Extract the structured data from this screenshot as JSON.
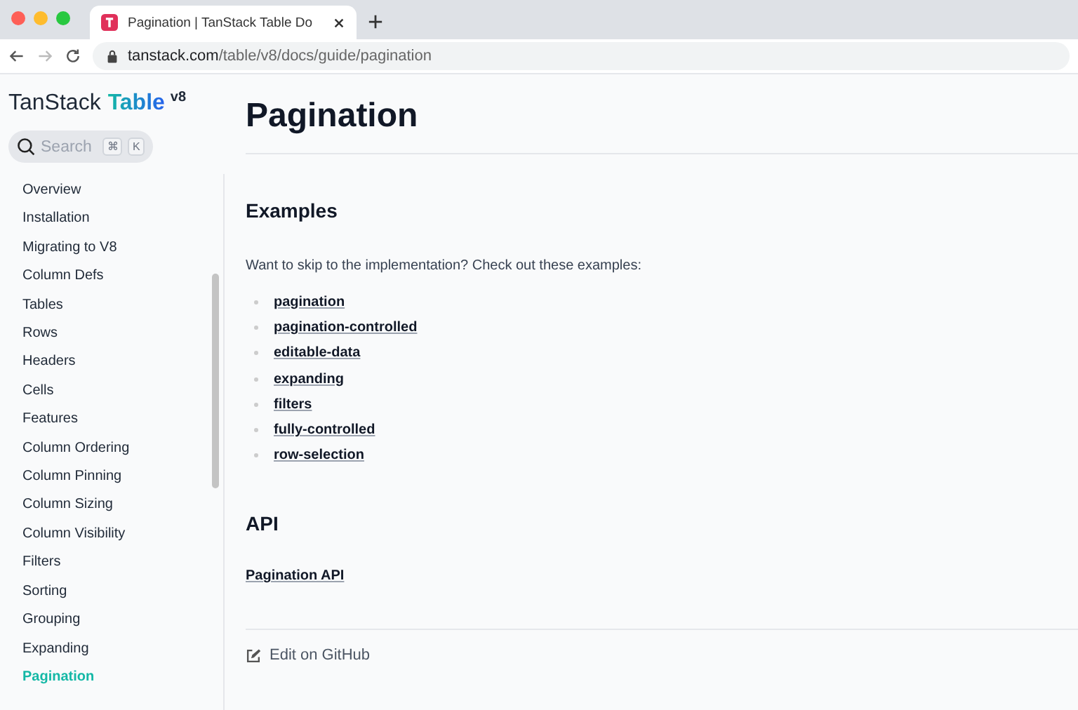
{
  "browser": {
    "tab_title": "Pagination | TanStack Table Do",
    "url_host": "tanstack.com",
    "url_path": "/table/v8/docs/guide/pagination"
  },
  "sidebar": {
    "logo": {
      "brand": "TanStack",
      "product": "Table",
      "version": "v8"
    },
    "search": {
      "placeholder": "Search",
      "keys": [
        "⌘",
        "K"
      ]
    },
    "items": [
      {
        "label": "Overview",
        "selected": false
      },
      {
        "label": "Installation",
        "selected": false
      },
      {
        "label": "Migrating to V8",
        "selected": false
      },
      {
        "label": "Column Defs",
        "selected": false
      },
      {
        "label": "Tables",
        "selected": false
      },
      {
        "label": "Rows",
        "selected": false
      },
      {
        "label": "Headers",
        "selected": false
      },
      {
        "label": "Cells",
        "selected": false
      },
      {
        "label": "Features",
        "selected": false
      },
      {
        "label": "Column Ordering",
        "selected": false
      },
      {
        "label": "Column Pinning",
        "selected": false
      },
      {
        "label": "Column Sizing",
        "selected": false
      },
      {
        "label": "Column Visibility",
        "selected": false
      },
      {
        "label": "Filters",
        "selected": false
      },
      {
        "label": "Sorting",
        "selected": false
      },
      {
        "label": "Grouping",
        "selected": false
      },
      {
        "label": "Expanding",
        "selected": false
      },
      {
        "label": "Pagination",
        "selected": true
      }
    ]
  },
  "content": {
    "title": "Pagination",
    "sections": [
      {
        "heading": "Examples",
        "intro": "Want to skip to the implementation? Check out these examples:",
        "links": [
          "pagination",
          "pagination-controlled",
          "editable-data",
          "expanding",
          "filters",
          "fully-controlled",
          "row-selection"
        ]
      },
      {
        "heading": "API",
        "link": "Pagination API"
      }
    ],
    "edit_link": "Edit on GitHub"
  }
}
